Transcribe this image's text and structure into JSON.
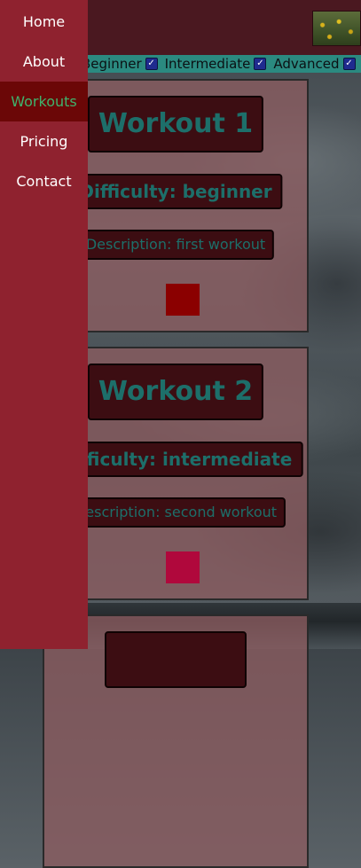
{
  "nav": {
    "items": [
      {
        "label": "Home",
        "active": false
      },
      {
        "label": "About",
        "active": false
      },
      {
        "label": "Workouts",
        "active": true
      },
      {
        "label": "Pricing",
        "active": false
      },
      {
        "label": "Contact",
        "active": false
      }
    ]
  },
  "filters": {
    "items": [
      {
        "label": "Beginner",
        "checked": true
      },
      {
        "label": "Intermediate",
        "checked": true
      },
      {
        "label": "Advanced",
        "checked": true
      }
    ]
  },
  "workouts": [
    {
      "title": "Workout 1",
      "difficulty": "Difficulty: beginner",
      "description": "Description: first workout",
      "color": "#8b0000"
    },
    {
      "title": "Workout 2",
      "difficulty": "Difficulty: intermediate",
      "description": "Description: second workout",
      "color": "#b0083c"
    }
  ],
  "colors": {
    "sidebar": "#8f222f",
    "active_nav": "#6b0707",
    "active_nav_text": "#3fb36c",
    "filterbar": "#2b8a80",
    "pill_bg": "#3c0d12",
    "pill_text": "#1d6f6a"
  }
}
